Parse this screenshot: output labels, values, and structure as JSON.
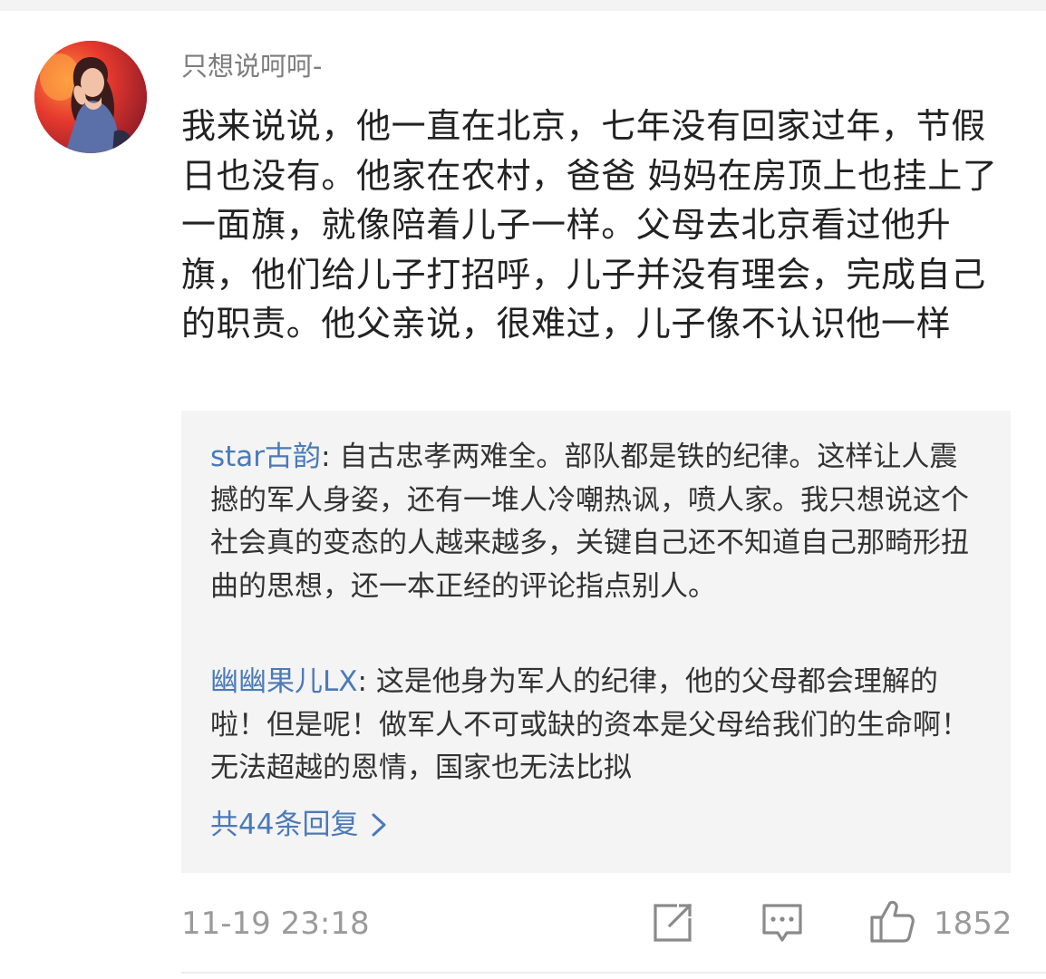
{
  "comment": {
    "username": "只想说呵呵-",
    "text": "我来说说，他一直在北京，七年没有回家过年，节假日也没有。他家在农村，爸爸 妈妈在房顶上也挂上了一面旗，就像陪着儿子一样。父母去北京看过他升旗，他们给儿子打招呼，儿子并没有理会，完成自己的职责。他父亲说，很难过，儿子像不认识他一样",
    "timestamp": "11-19 23:18",
    "like_count": "1852"
  },
  "replies": [
    {
      "author": "star古韵",
      "separator": ": ",
      "text": "自古忠孝两难全。部队都是铁的纪律。这样让人震撼的军人身姿，还有一堆人冷嘲热讽，喷人家。我只想说这个社会真的变态的人越来越多，关键自己还不知道自己那畸形扭曲的思想，还一本正经的评论指点别人。"
    },
    {
      "author": "幽幽果儿LX",
      "separator": ": ",
      "text": "这是他身为军人的纪律，他的父母都会理解的啦！但是呢！做军人不可或缺的资本是父母给我们的生命啊！无法超越的恩情，国家也无法比拟"
    }
  ],
  "more_replies_label": "共44条回复",
  "icons": {
    "share": "share-icon",
    "comment": "comment-icon",
    "like": "thumbs-up-icon",
    "chevron": "chevron-right-icon"
  },
  "colors": {
    "link_blue": "#4a7ab8",
    "meta_gray": "#9a9a9a",
    "reply_bg": "#f4f4f4"
  }
}
